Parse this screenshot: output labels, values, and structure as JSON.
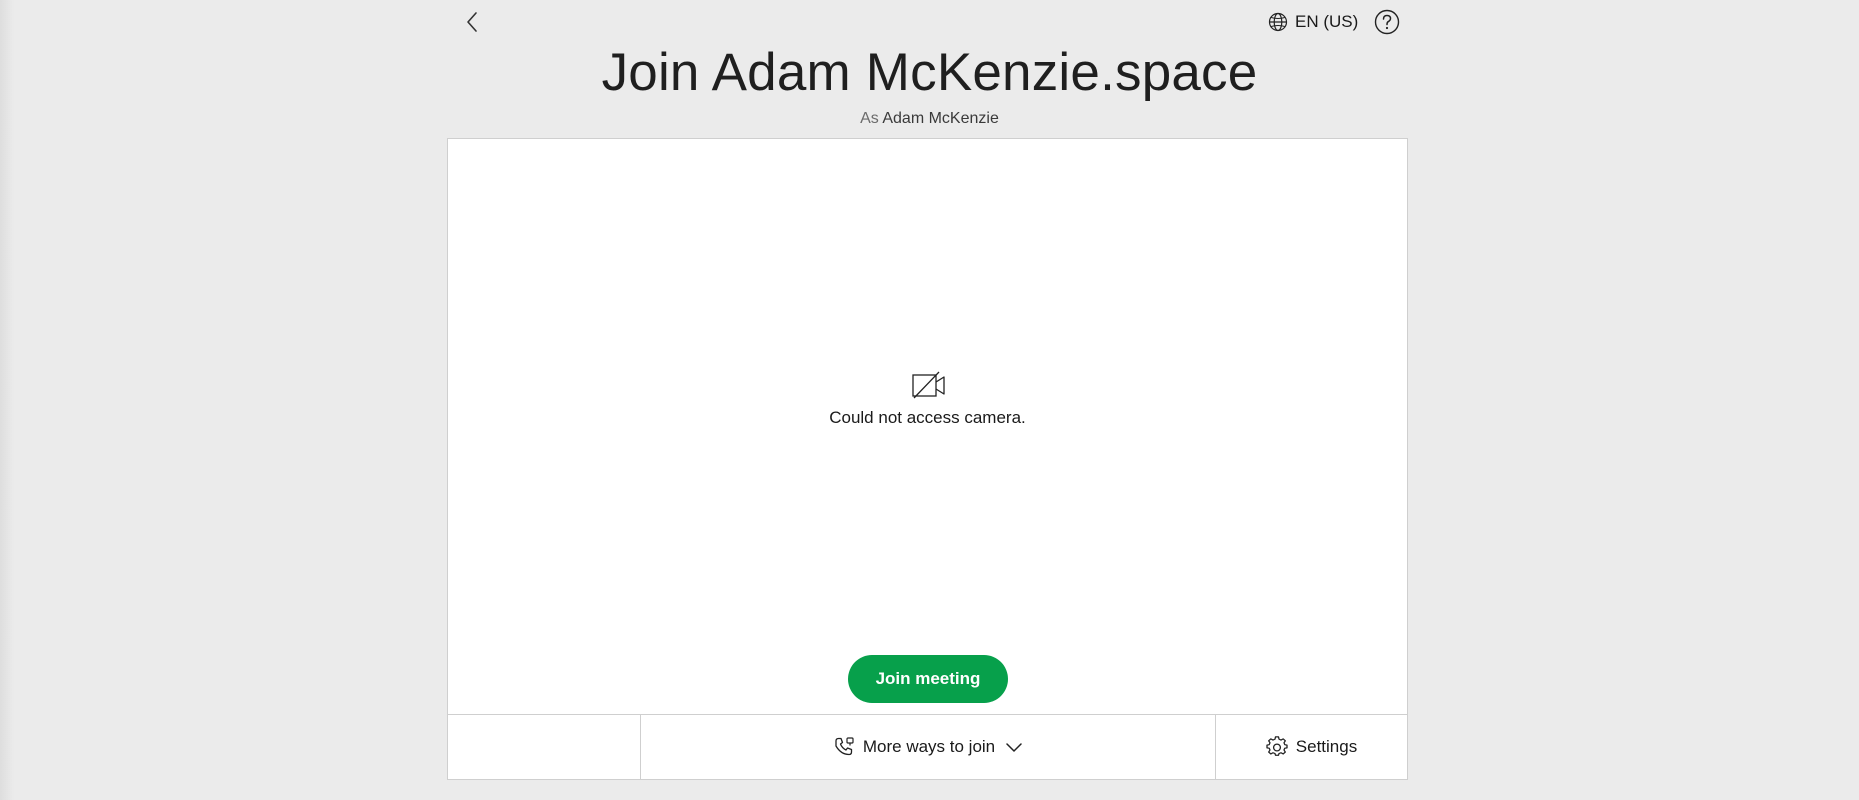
{
  "header": {
    "back_icon": "chevron-left-icon",
    "language_icon": "globe-icon",
    "language_label": "EN (US)",
    "help_icon": "question-circle-icon"
  },
  "title": "Join Adam McKenzie.space",
  "subtitle": {
    "prefix": "As",
    "user_name": "Adam McKenzie"
  },
  "preview": {
    "camera_icon": "camera-off-icon",
    "message": "Could not access camera."
  },
  "join_button": {
    "label": "Join meeting",
    "color": "#07a04b"
  },
  "bottom_bar": {
    "more_ways_icon": "phone-icon",
    "more_ways_label": "More ways to join",
    "more_ways_chevron": "chevron-down-icon",
    "settings_icon": "gear-icon",
    "settings_label": "Settings"
  }
}
